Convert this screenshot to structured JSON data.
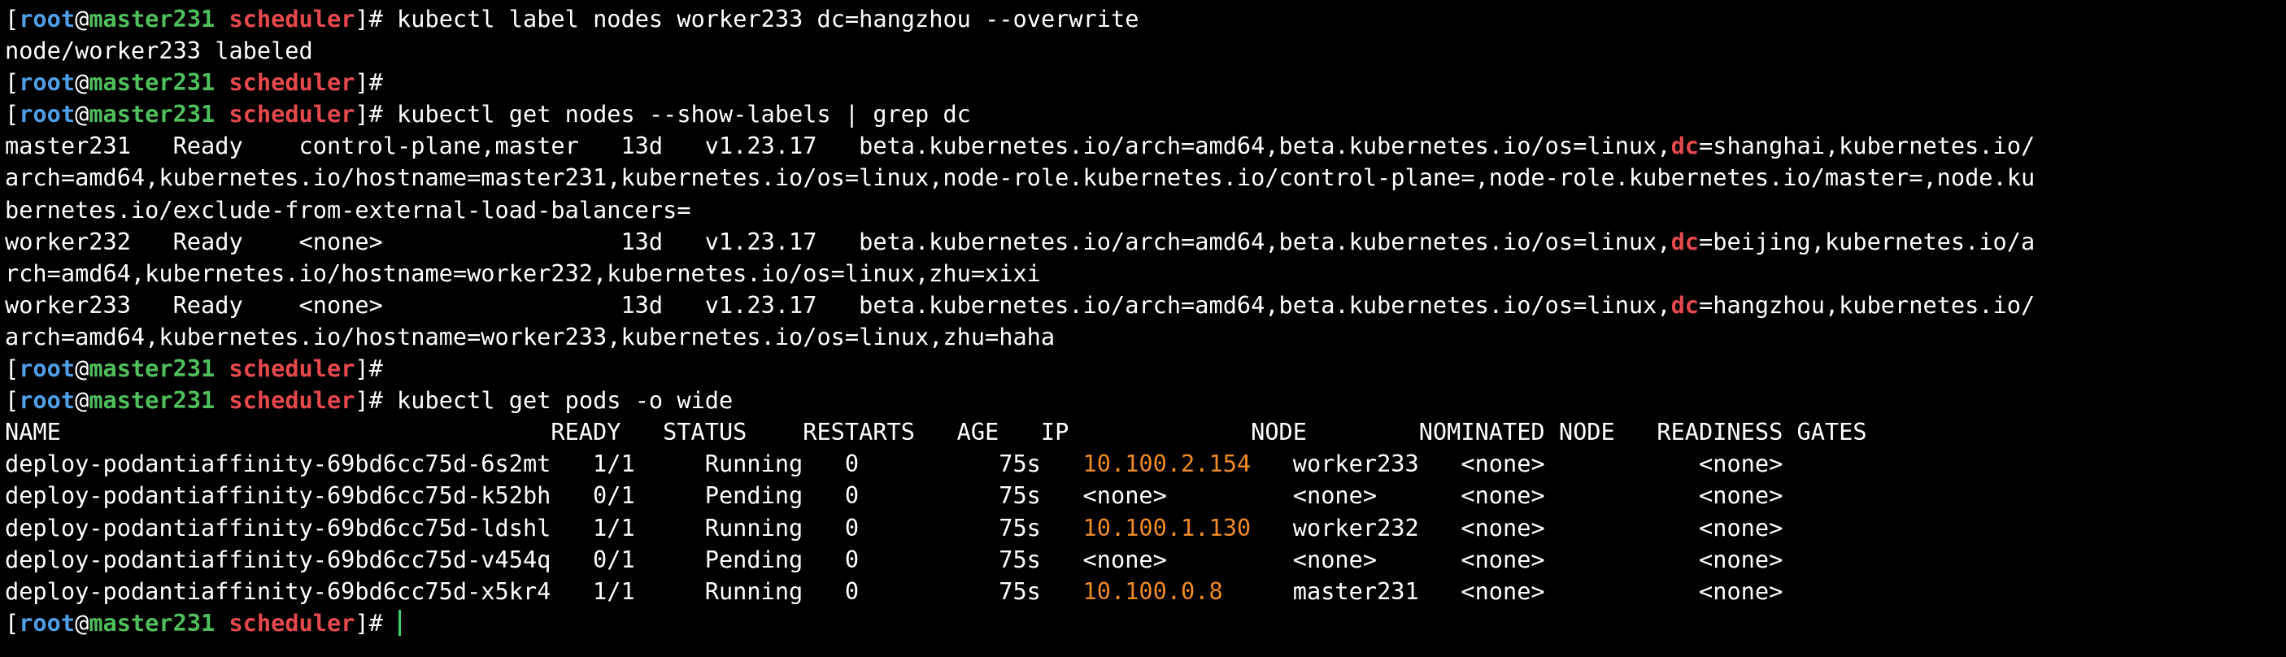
{
  "colors": {
    "background": "#000000",
    "text": "#ffffff",
    "prompt_user": "#4f9ee8",
    "prompt_host": "#4fbf5b",
    "prompt_dir": "#e5484d",
    "grep_match": "#e5484d",
    "ip": "#f08a24",
    "cursor": "#3ecf6e"
  },
  "prompt": {
    "open": "[",
    "user": "root",
    "at": "@",
    "host": "master231",
    "space": " ",
    "dir": "scheduler",
    "close": "]#"
  },
  "lines": {
    "cmd1": " kubectl label nodes worker233 dc=hangzhou --overwrite",
    "out1": "node/worker233 labeled",
    "cmd3": " kubectl get nodes --show-labels | grep dc",
    "n1a": "master231   Ready    control-plane,master   13d   v1.23.17   beta.kubernetes.io/arch=amd64,beta.kubernetes.io/os=linux,",
    "n1m": "dc",
    "n1b": "=shanghai,kubernetes.io/",
    "n1c": "arch=amd64,kubernetes.io/hostname=master231,kubernetes.io/os=linux,node-role.kubernetes.io/control-plane=,node-role.kubernetes.io/master=,node.ku",
    "n1d": "bernetes.io/exclude-from-external-load-balancers=",
    "n2a": "worker232   Ready    <none>                 13d   v1.23.17   beta.kubernetes.io/arch=amd64,beta.kubernetes.io/os=linux,",
    "n2m": "dc",
    "n2b": "=beijing,kubernetes.io/a",
    "n2c": "rch=amd64,kubernetes.io/hostname=worker232,kubernetes.io/os=linux,zhu=xixi",
    "n3a": "worker233   Ready    <none>                 13d   v1.23.17   beta.kubernetes.io/arch=amd64,beta.kubernetes.io/os=linux,",
    "n3m": "dc",
    "n3b": "=hangzhou,kubernetes.io/",
    "n3c": "arch=amd64,kubernetes.io/hostname=worker233,kubernetes.io/os=linux,zhu=haha",
    "cmd5": " kubectl get pods -o wide",
    "pods_header": "NAME                                   READY   STATUS    RESTARTS   AGE   IP             NODE        NOMINATED NODE   READINESS GATES"
  },
  "pods": [
    {
      "pre": "deploy-podantiaffinity-69bd6cc75d-6s2mt   1/1     Running   0          75s   ",
      "ip": "10.100.2.154",
      "post": "   worker233   <none>           <none>"
    },
    {
      "pre": "deploy-podantiaffinity-69bd6cc75d-k52bh   0/1     Pending   0          75s   ",
      "ip": "<none>",
      "post": "         <none>      <none>           <none>"
    },
    {
      "pre": "deploy-podantiaffinity-69bd6cc75d-ldshl   1/1     Running   0          75s   ",
      "ip": "10.100.1.130",
      "post": "   worker232   <none>           <none>"
    },
    {
      "pre": "deploy-podantiaffinity-69bd6cc75d-v454q   0/1     Pending   0          75s   ",
      "ip": "<none>",
      "post": "         <none>      <none>           <none>"
    },
    {
      "pre": "deploy-podantiaffinity-69bd6cc75d-x5kr4   1/1     Running   0          75s   ",
      "ip": "10.100.0.8",
      "post": "     master231   <none>           <none>"
    }
  ]
}
